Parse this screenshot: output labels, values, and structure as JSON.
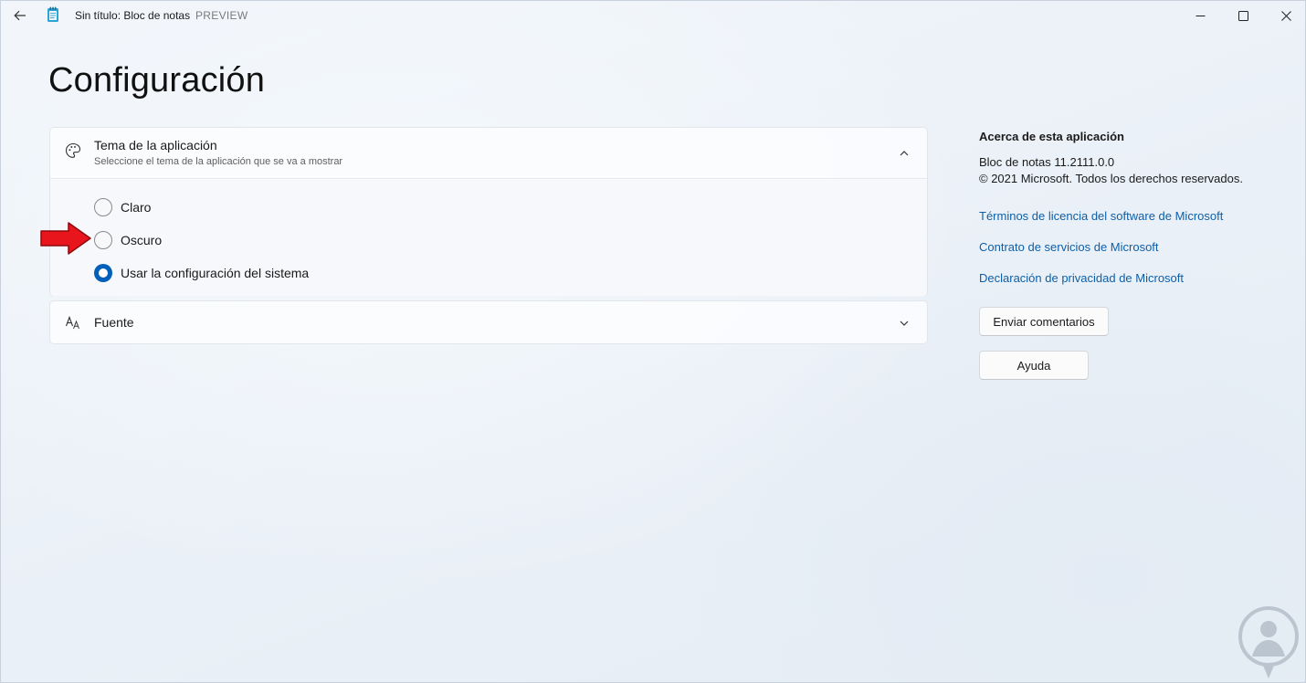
{
  "titlebar": {
    "title": "Sin título: Bloc de notas",
    "preview": "PREVIEW",
    "back_icon": "back-arrow-icon",
    "app_icon": "notepad-icon"
  },
  "page": {
    "title": "Configuración"
  },
  "theme_card": {
    "icon": "palette-icon",
    "title": "Tema de la aplicación",
    "subtitle": "Seleccione el tema de la aplicación que se va a mostrar",
    "expanded": true,
    "options": [
      {
        "label": "Claro",
        "checked": false
      },
      {
        "label": "Oscuro",
        "checked": false
      },
      {
        "label": "Usar la configuración del sistema",
        "checked": true
      }
    ]
  },
  "font_card": {
    "icon": "font-icon",
    "title": "Fuente",
    "expanded": false
  },
  "about": {
    "title": "Acerca de esta aplicación",
    "version": "Bloc de notas 11.2111.0.0",
    "copyright": "© 2021 Microsoft. Todos los derechos reservados.",
    "links": [
      "Términos de licencia del software de Microsoft",
      "Contrato de servicios de Microsoft",
      "Declaración de privacidad de Microsoft"
    ],
    "feedback_button": "Enviar comentarios",
    "help_button": "Ayuda"
  },
  "colors": {
    "accent": "#005fb8",
    "link": "#0e5fa8",
    "annotation_arrow": "#e8161c"
  }
}
